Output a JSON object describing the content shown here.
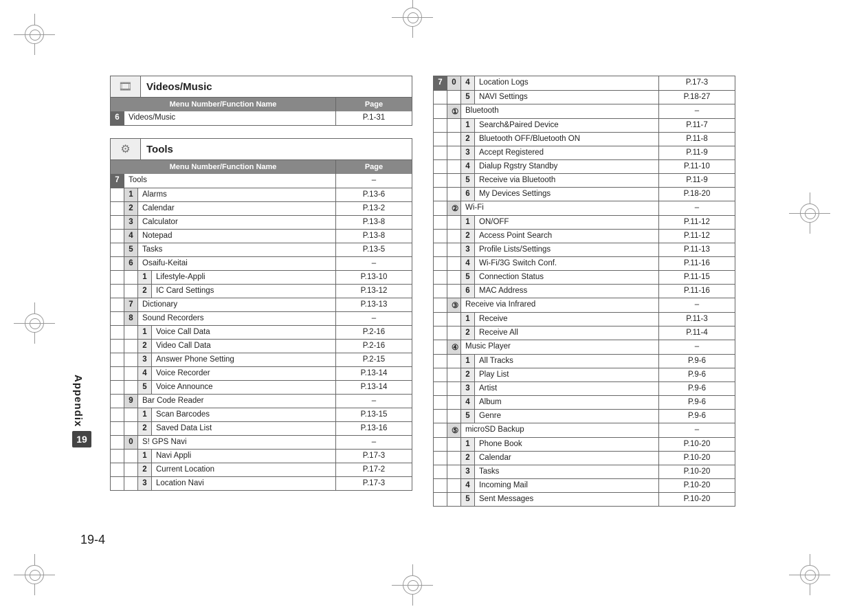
{
  "side": {
    "label": "Appendix",
    "chapter": "19"
  },
  "page_number": "19-4",
  "header_labels": {
    "name": "Menu Number/Function Name",
    "page": "Page"
  },
  "sections": [
    {
      "title": "Videos/Music",
      "icon_glyph": "🎞",
      "icon_name": "film-icon",
      "rows": [
        {
          "chap": "6",
          "name": "Videos/Music",
          "page": "P.1-31"
        }
      ]
    },
    {
      "title": "Tools",
      "icon_glyph": "⚙",
      "icon_name": "gear-icon",
      "rows": [
        {
          "chap": "7",
          "name": "Tools",
          "page": "–"
        },
        {
          "n1": "1",
          "name": "Alarms",
          "page": "P.13-6"
        },
        {
          "n1": "2",
          "name": "Calendar",
          "page": "P.13-2"
        },
        {
          "n1": "3",
          "name": "Calculator",
          "page": "P.13-8"
        },
        {
          "n1": "4",
          "name": "Notepad",
          "page": "P.13-8"
        },
        {
          "n1": "5",
          "name": "Tasks",
          "page": "P.13-5"
        },
        {
          "n1": "6",
          "name": "Osaifu-Keitai",
          "page": "–"
        },
        {
          "n2": "1",
          "name": "Lifestyle-Appli",
          "page": "P.13-10"
        },
        {
          "n2": "2",
          "name": "IC Card Settings",
          "page": "P.13-12"
        },
        {
          "n1": "7",
          "name": "Dictionary",
          "page": "P.13-13"
        },
        {
          "n1": "8",
          "name": "Sound Recorders",
          "page": "–"
        },
        {
          "n2": "1",
          "name": "Voice Call Data",
          "page": "P.2-16"
        },
        {
          "n2": "2",
          "name": "Video Call Data",
          "page": "P.2-16"
        },
        {
          "n2": "3",
          "name": "Answer Phone Setting",
          "page": "P.2-15"
        },
        {
          "n2": "4",
          "name": "Voice Recorder",
          "page": "P.13-14"
        },
        {
          "n2": "5",
          "name": "Voice Announce",
          "page": "P.13-14"
        },
        {
          "n1": "9",
          "name": "Bar Code Reader",
          "page": "–"
        },
        {
          "n2": "1",
          "name": "Scan Barcodes",
          "page": "P.13-15"
        },
        {
          "n2": "2",
          "name": "Saved Data List",
          "page": "P.13-16"
        },
        {
          "n1": "0",
          "name": "S! GPS Navi",
          "page": "–"
        },
        {
          "n2": "1",
          "name": "Navi Appli",
          "page": "P.17-3"
        },
        {
          "n2": "2",
          "name": "Current Location",
          "page": "P.17-2"
        },
        {
          "n2": "3",
          "name": "Location Navi",
          "page": "P.17-3"
        }
      ]
    }
  ],
  "right_rows": [
    {
      "chap": "7",
      "n1": "0",
      "n2": "4",
      "name": "Location Logs",
      "page": "P.17-3"
    },
    {
      "n2": "5",
      "name": "NAVI Settings",
      "page": "P.18-27"
    },
    {
      "n1": "①",
      "name": "Bluetooth",
      "page": "–"
    },
    {
      "n2": "1",
      "name": "Search&Paired Device",
      "page": "P.11-7"
    },
    {
      "n2": "2",
      "name": "Bluetooth OFF/Bluetooth ON",
      "page": "P.11-8"
    },
    {
      "n2": "3",
      "name": "Accept Registered",
      "page": "P.11-9"
    },
    {
      "n2": "4",
      "name": "Dialup Rgstry Standby",
      "page": "P.11-10"
    },
    {
      "n2": "5",
      "name": "Receive via Bluetooth",
      "page": "P.11-9"
    },
    {
      "n2": "6",
      "name": "My Devices Settings",
      "page": "P.18-20"
    },
    {
      "n1": "②",
      "name": "Wi-Fi",
      "page": "–"
    },
    {
      "n2": "1",
      "name": "ON/OFF",
      "page": "P.11-12"
    },
    {
      "n2": "2",
      "name": "Access Point Search",
      "page": "P.11-12"
    },
    {
      "n2": "3",
      "name": "Profile Lists/Settings",
      "page": "P.11-13"
    },
    {
      "n2": "4",
      "name": "Wi-Fi/3G Switch Conf.",
      "page": "P.11-16"
    },
    {
      "n2": "5",
      "name": "Connection Status",
      "page": "P.11-15"
    },
    {
      "n2": "6",
      "name": "MAC Address",
      "page": "P.11-16"
    },
    {
      "n1": "③",
      "name": "Receive via Infrared",
      "page": "–"
    },
    {
      "n2": "1",
      "name": "Receive",
      "page": "P.11-3"
    },
    {
      "n2": "2",
      "name": "Receive All",
      "page": "P.11-4"
    },
    {
      "n1": "④",
      "name": "Music Player",
      "page": "–"
    },
    {
      "n2": "1",
      "name": "All Tracks",
      "page": "P.9-6"
    },
    {
      "n2": "2",
      "name": "Play List",
      "page": "P.9-6"
    },
    {
      "n2": "3",
      "name": "Artist",
      "page": "P.9-6"
    },
    {
      "n2": "4",
      "name": "Album",
      "page": "P.9-6"
    },
    {
      "n2": "5",
      "name": "Genre",
      "page": "P.9-6"
    },
    {
      "n1": "⑤",
      "name": "microSD Backup",
      "page": "–"
    },
    {
      "n2": "1",
      "name": "Phone Book",
      "page": "P.10-20"
    },
    {
      "n2": "2",
      "name": "Calendar",
      "page": "P.10-20"
    },
    {
      "n2": "3",
      "name": "Tasks",
      "page": "P.10-20"
    },
    {
      "n2": "4",
      "name": "Incoming Mail",
      "page": "P.10-20"
    },
    {
      "n2": "5",
      "name": "Sent Messages",
      "page": "P.10-20"
    }
  ]
}
